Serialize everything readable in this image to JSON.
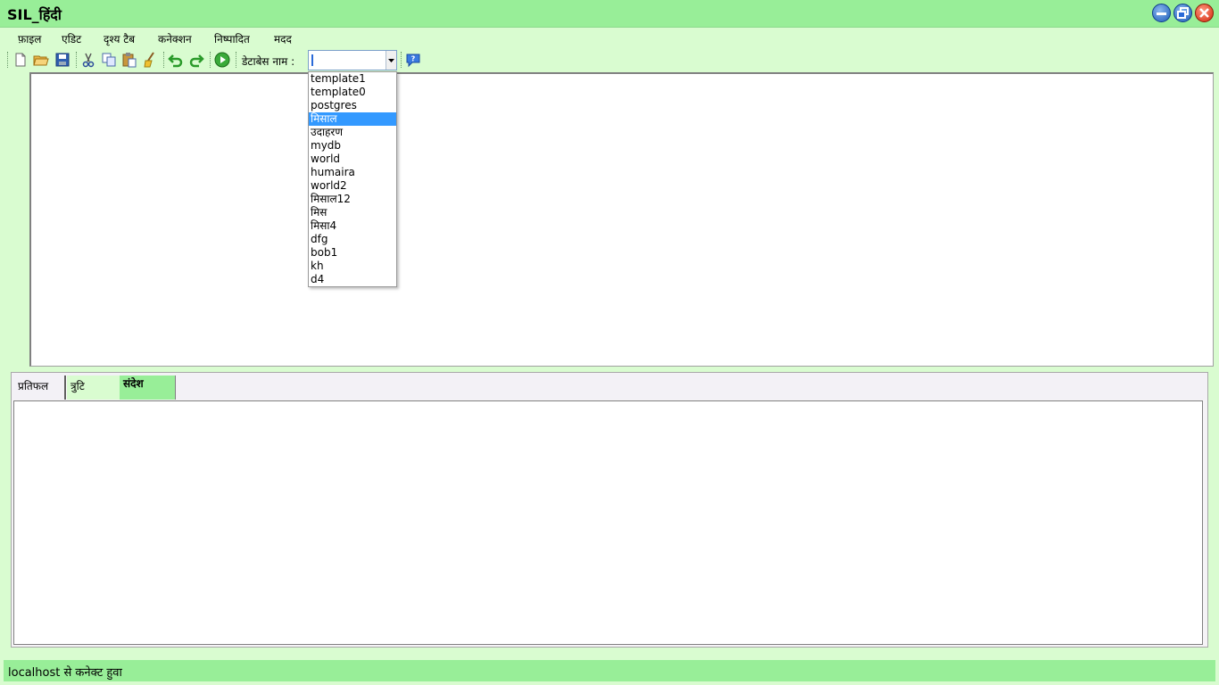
{
  "window": {
    "title": "SIL_हिंदी"
  },
  "menu": {
    "items": [
      "फ़ाइल",
      "एडिट",
      "दृश्य टैब",
      "कनेक्शन",
      "निष्पादित",
      "मदद"
    ]
  },
  "toolbar": {
    "db_label": "डेटाबेस नाम :",
    "db_value": "",
    "icons": [
      "new-file-icon",
      "open-folder-icon",
      "save-icon",
      "cut-icon",
      "copy-icon",
      "paste-icon",
      "clear-brush-icon",
      "undo-icon",
      "redo-icon",
      "execute-icon",
      "help-icon"
    ]
  },
  "db_options": {
    "items": [
      "template1",
      "template0",
      "postgres",
      "मिसाल",
      "उदाहरण",
      "mydb",
      "world",
      "humaira",
      "world2",
      "मिसाल12",
      "मिस",
      "मिसा4",
      "dfg",
      "bob1",
      "kh",
      "d4"
    ],
    "selected_index": 3
  },
  "tabs": {
    "items": [
      "प्रतिफल",
      "त्रुटि",
      "संदेश"
    ],
    "active": "संदेश"
  },
  "status": {
    "text": "localhost  से कनेक्ट हुवा"
  },
  "colors": {
    "chrome": "#98ee98",
    "background": "#d9fcd0",
    "selection": "#3399ff"
  }
}
